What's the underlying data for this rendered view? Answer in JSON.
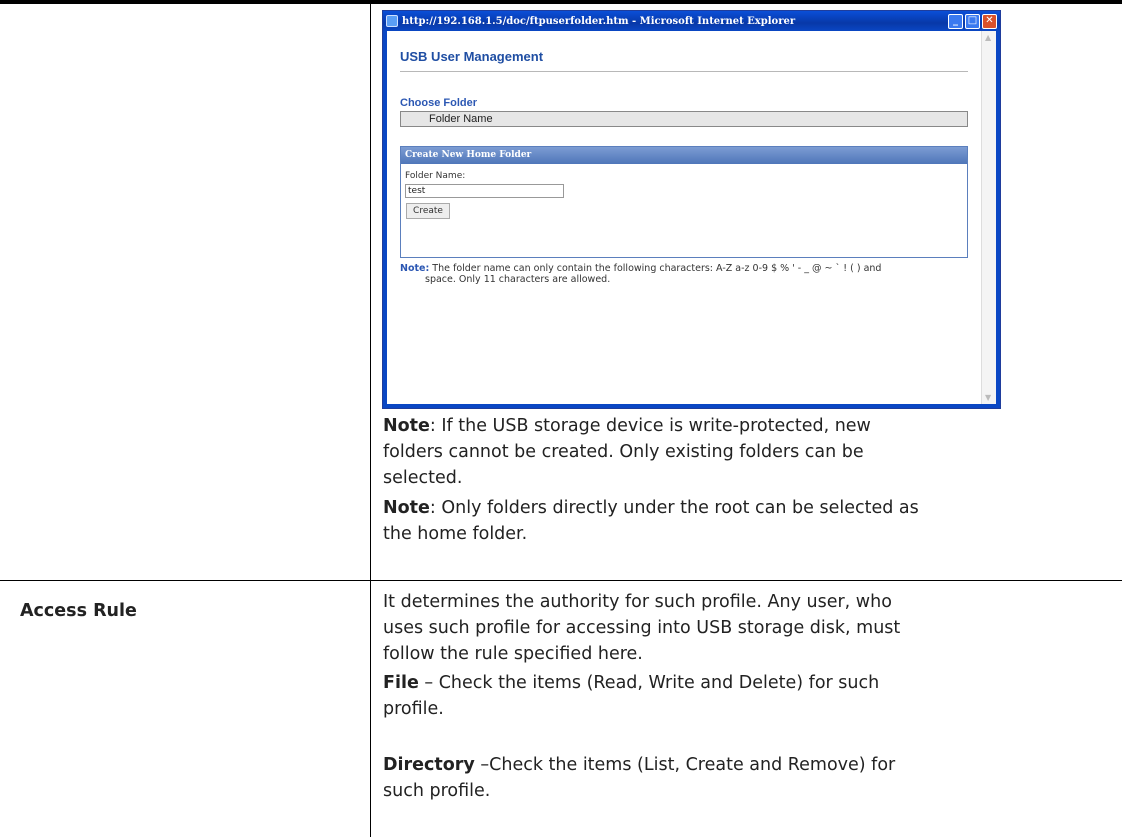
{
  "window": {
    "title": "http://192.168.1.5/doc/ftpuserfolder.htm - Microsoft Internet Explorer",
    "min_glyph": "_",
    "max_glyph": "□",
    "close_glyph": "✕"
  },
  "dialog": {
    "title": "USB User Management",
    "choose_folder_label": "Choose Folder",
    "folder_column_header": "Folder Name",
    "create_panel_title": "Create New Home Folder",
    "folder_name_label": "Folder Name:",
    "folder_name_value": "test",
    "create_button": "Create",
    "note_label": "Note:",
    "note_line1": "The folder name can only contain the following characters: A-Z a-z 0-9 $ % ' - _ @ ~ ` ! ( ) and",
    "note_line2": "space. Only 11 characters are allowed."
  },
  "doc": {
    "note1_label": "Note",
    "note1_l1": ": If the USB storage device is write-protected, new",
    "note1_l2": "folders cannot be created. Only existing folders can be",
    "note1_l3": "selected.",
    "note2_label": "Note",
    "note2_l1": ": Only folders directly under the root can be selected as",
    "note2_l2": "the home folder.",
    "access_rule_heading": "Access Rule",
    "access_l1": "It determines the authority for such profile. Any user, who",
    "access_l2": "uses such profile for accessing into USB storage disk, must",
    "access_l3": "follow the rule specified here.",
    "file_label": "File",
    "file_l1": " – Check the items (Read, Write and Delete) for such",
    "file_l2": "profile.",
    "dir_label": "Directory",
    "dir_l1": " –Check the items (List, Create and Remove) for",
    "dir_l2": "such profile."
  }
}
